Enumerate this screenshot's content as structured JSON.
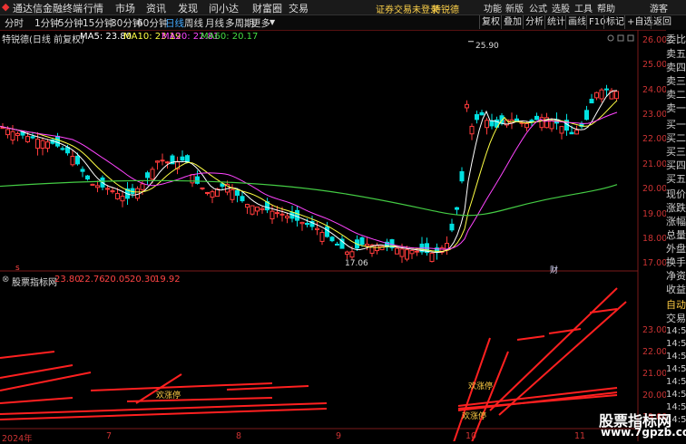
{
  "topbar": {
    "app_name": "通达信金融终端",
    "menus": [
      "行情",
      "市场",
      "资讯",
      "发现",
      "问小达",
      "财富圈",
      "交易"
    ],
    "notice": "证券交易未登录",
    "stock_name_tag": "特锐德",
    "right_items": [
      "功能",
      "新版",
      "公式",
      "选股",
      "工具",
      "帮助"
    ],
    "user": "游客"
  },
  "toolbar": {
    "periods": [
      "分时",
      "1分钟",
      "5分钟",
      "15分钟",
      "30分钟",
      "60分钟",
      "日线",
      "周线",
      "月线",
      "多周期",
      "更多"
    ],
    "active_period": "日线",
    "right_buttons": [
      "复权",
      "叠加",
      "分析",
      "统计",
      "画线",
      "F10",
      "标记",
      "+自选",
      "返回"
    ]
  },
  "main_chart": {
    "title": "特锐德(日线 前复权)",
    "ma": [
      {
        "label": "MA5: 23.80",
        "color": "#ffffff"
      },
      {
        "label": "MA10: 23.19",
        "color": "#ffff44"
      },
      {
        "label": "MA20: 22.81",
        "color": "#ff44ff"
      },
      {
        "label": "MA60: 20.17",
        "color": "#44dd44"
      }
    ],
    "y_ticks": [
      "26.00",
      "25.00",
      "24.00",
      "23.00",
      "22.00",
      "21.00",
      "20.00",
      "19.00",
      "18.00",
      "17.00"
    ],
    "high_label": "25.90",
    "low_label": "17.06",
    "markers": [
      "s",
      "财"
    ]
  },
  "indicator": {
    "title": "股票指标网",
    "values": [
      {
        "label": "23.80",
        "color": "#ff4444"
      },
      {
        "label": "22.76",
        "color": "#ff4444"
      },
      {
        "label": "20.05",
        "color": "#ff4444"
      },
      {
        "label": "20.30",
        "color": "#ff4444"
      },
      {
        "label": "19.92",
        "color": "#ff4444"
      }
    ],
    "y_ticks": [
      "23.00",
      "22.00",
      "21.00",
      "20.00",
      "19.00"
    ],
    "annotations": [
      "欢涨停",
      "欢涨停",
      "欢涨停"
    ]
  },
  "x_axis": {
    "labels": [
      "2024年",
      "7",
      "8",
      "9",
      "10",
      "11"
    ]
  },
  "right_panel": {
    "items": [
      "委比",
      "卖五",
      "卖四",
      "卖三",
      "卖二",
      "卖一",
      "买一",
      "买二",
      "买三",
      "买四",
      "买五",
      "现价",
      "涨跌",
      "涨幅",
      "总量",
      "外盘",
      "换手",
      "净资",
      "收益",
      "自动",
      "交易"
    ],
    "times": [
      "14:5",
      "14:5",
      "14:5",
      "14:5",
      "14:5",
      "14:5",
      "14:5",
      "14:5"
    ]
  },
  "watermark": {
    "name": "股票指标网",
    "url": "www.7gpzb.com"
  }
}
